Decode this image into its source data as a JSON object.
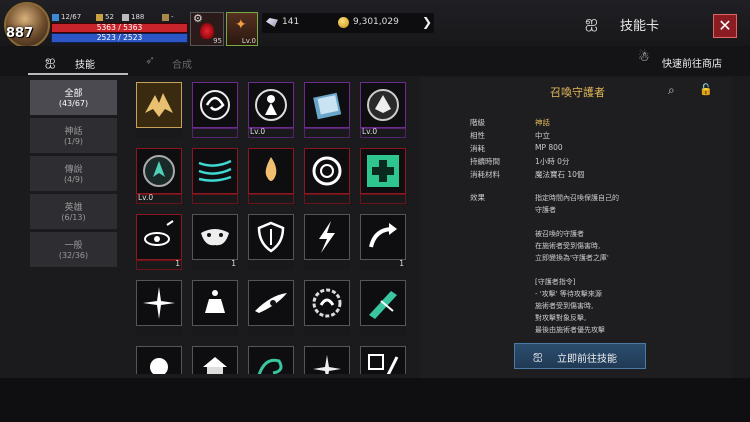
{
  "player": {
    "level": "887",
    "stat_a": "12/67",
    "stat_b": "52",
    "stat_c": "188",
    "stat_d": "-",
    "hp": "5363 / 5363",
    "mp": "2523 / 2523",
    "potion_count": "95",
    "buff_level": "Lv.0"
  },
  "currency": {
    "diamond": "141",
    "gold": "9,301,029"
  },
  "header": {
    "title": "技能卡",
    "close": "✕"
  },
  "tabs": [
    {
      "label": "技能"
    },
    {
      "label": "合成"
    }
  ],
  "shop": {
    "label": "快速前往商店"
  },
  "categories": [
    {
      "name": "全部",
      "count": "(43/67)"
    },
    {
      "name": "神話",
      "count": "(1/9)"
    },
    {
      "name": "傳說",
      "count": "(4/9)"
    },
    {
      "name": "英雄",
      "count": "(6/13)"
    },
    {
      "name": "一般",
      "count": "(32/36)"
    }
  ],
  "cards": [
    {
      "icon": "winged-beast-icon",
      "sub": "",
      "qty": ""
    },
    {
      "icon": "dragon-spiral-icon",
      "sub": "",
      "qty": ""
    },
    {
      "icon": "guardian-figure-icon",
      "sub": "Lv.0",
      "qty": ""
    },
    {
      "icon": "summon-book-icon",
      "sub": "",
      "qty": ""
    },
    {
      "icon": "beast-crest-icon",
      "sub": "Lv.0",
      "qty": ""
    },
    {
      "icon": "green-crest-icon",
      "sub": "Lv.0",
      "qty": ""
    },
    {
      "icon": "wind-lines-icon",
      "sub": "",
      "qty": ""
    },
    {
      "icon": "flame-drop-icon",
      "sub": "",
      "qty": ""
    },
    {
      "icon": "vortex-icon",
      "sub": "",
      "qty": ""
    },
    {
      "icon": "heal-cross-icon",
      "sub": "",
      "qty": ""
    },
    {
      "icon": "eye-arrow-icon",
      "sub": "",
      "qty": "1"
    },
    {
      "icon": "mask-icon",
      "sub": "",
      "qty": "1"
    },
    {
      "icon": "shield-icon",
      "sub": "",
      "qty": ""
    },
    {
      "icon": "lightning-icon",
      "sub": "",
      "qty": ""
    },
    {
      "icon": "curved-arrow-icon",
      "sub": "",
      "qty": "1"
    },
    {
      "icon": "burst-icon",
      "sub": "",
      "qty": ""
    },
    {
      "icon": "altar-icon",
      "sub": "",
      "qty": ""
    },
    {
      "icon": "slash-eye-icon",
      "sub": "",
      "qty": ""
    },
    {
      "icon": "serpent-icon",
      "sub": "",
      "qty": ""
    },
    {
      "icon": "green-slash-icon",
      "sub": "",
      "qty": ""
    },
    {
      "icon": "orb-icon",
      "sub": "",
      "qty": ""
    },
    {
      "icon": "temple-icon",
      "sub": "",
      "qty": ""
    },
    {
      "icon": "swirl-icon",
      "sub": "",
      "qty": ""
    },
    {
      "icon": "sparkle-icon",
      "sub": "",
      "qty": ""
    },
    {
      "icon": "weapons-icon",
      "sub": "",
      "qty": ""
    }
  ],
  "detail": {
    "name": "召喚守護者",
    "props": [
      {
        "k": "階級",
        "v": "神話",
        "accent": true
      },
      {
        "k": "相性",
        "v": "中立"
      },
      {
        "k": "消耗",
        "v": "MP 800"
      },
      {
        "k": "持續時間",
        "v": "1小時 0分"
      },
      {
        "k": "消耗材料",
        "v": "魔法寶石 10個"
      }
    ],
    "effect_label": "效果",
    "effect_lines": [
      "指定時間內召喚保護自己的",
      "守護者",
      "",
      "被召喚的守護者",
      "在施術者受到傷害時,",
      "立即變換為'守護者之庫'",
      "",
      "[守護者指令]",
      "- '攻擊' 等待攻擊來源",
      "施術者受到傷害時,",
      "對攻擊對象反擊,",
      "最後由施術者優先攻擊"
    ],
    "goto_label": "立即前往技能"
  },
  "colors": {
    "accent_gold": "#e3b95a",
    "close_red": "#8b1d22",
    "button_blue": "#2c4d6e"
  }
}
